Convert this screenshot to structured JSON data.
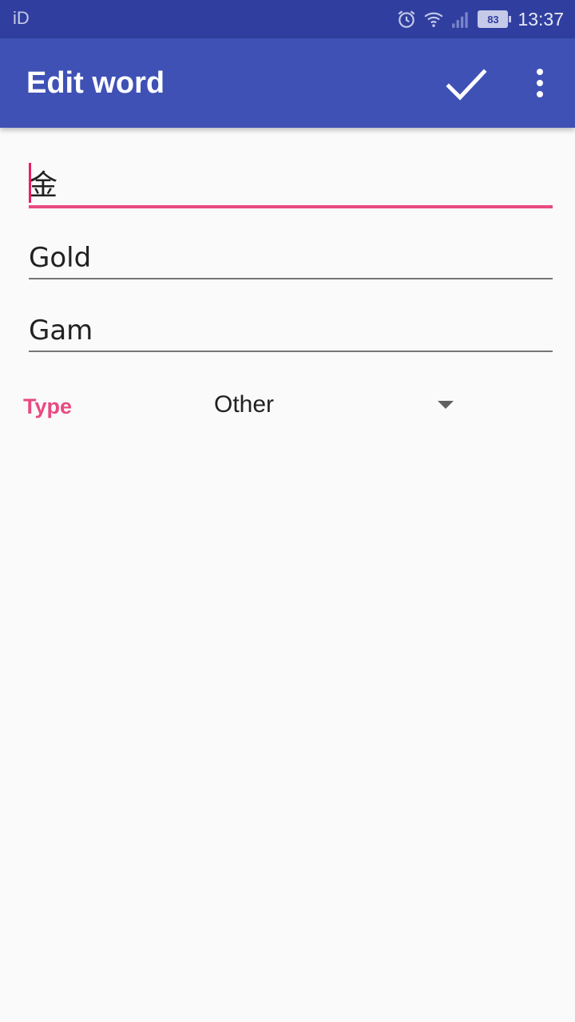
{
  "status_bar": {
    "carrier": "iD",
    "battery_level": "83",
    "time": "13:37",
    "icons": [
      "alarm-icon",
      "wifi-icon",
      "signal-icon",
      "battery-icon"
    ]
  },
  "app_bar": {
    "title": "Edit word",
    "actions": [
      "check-icon",
      "more-vert-icon"
    ],
    "color": "#3f51b5"
  },
  "form": {
    "word_value": "金",
    "meaning_value": "Gold",
    "reading_value": "Gam",
    "type_label": "Type",
    "type_selected": "Other"
  },
  "colors": {
    "accent": "#e91e63",
    "primary": "#3f51b5",
    "primary_dark": "#303f9f"
  }
}
